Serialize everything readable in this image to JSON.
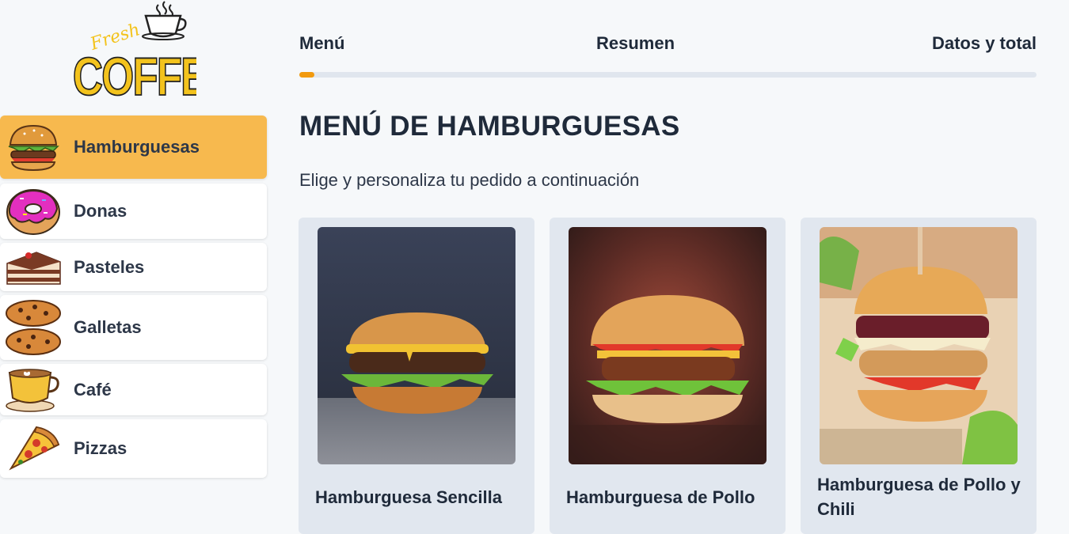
{
  "brand": {
    "script_text": "Fresh",
    "name": "COFFEE"
  },
  "sidebar": {
    "categories": [
      {
        "label": "Hamburguesas",
        "icon": "burger-icon",
        "active": true
      },
      {
        "label": "Donas",
        "icon": "donut-icon",
        "active": false
      },
      {
        "label": "Pasteles",
        "icon": "cake-icon",
        "active": false
      },
      {
        "label": "Galletas",
        "icon": "cookie-icon",
        "active": false
      },
      {
        "label": "Café",
        "icon": "coffee-cup-icon",
        "active": false
      },
      {
        "label": "Pizzas",
        "icon": "pizza-icon",
        "active": false
      }
    ]
  },
  "steps": [
    {
      "label": "Menú"
    },
    {
      "label": "Resumen"
    },
    {
      "label": "Datos y total"
    }
  ],
  "progress": {
    "percent": 2,
    "color": "#f29a0e"
  },
  "main": {
    "title": "MENÚ DE HAMBURGUESAS",
    "subtitle": "Elige y personaliza tu pedido a continuación"
  },
  "products": [
    {
      "name": "Hamburguesa Sencilla"
    },
    {
      "name": "Hamburguesa de Pollo"
    },
    {
      "name": "Hamburguesa de Pollo y Chili"
    }
  ],
  "colors": {
    "accent": "#f7b94e",
    "background": "#f6f8fa",
    "card": "#e1e7ef"
  }
}
